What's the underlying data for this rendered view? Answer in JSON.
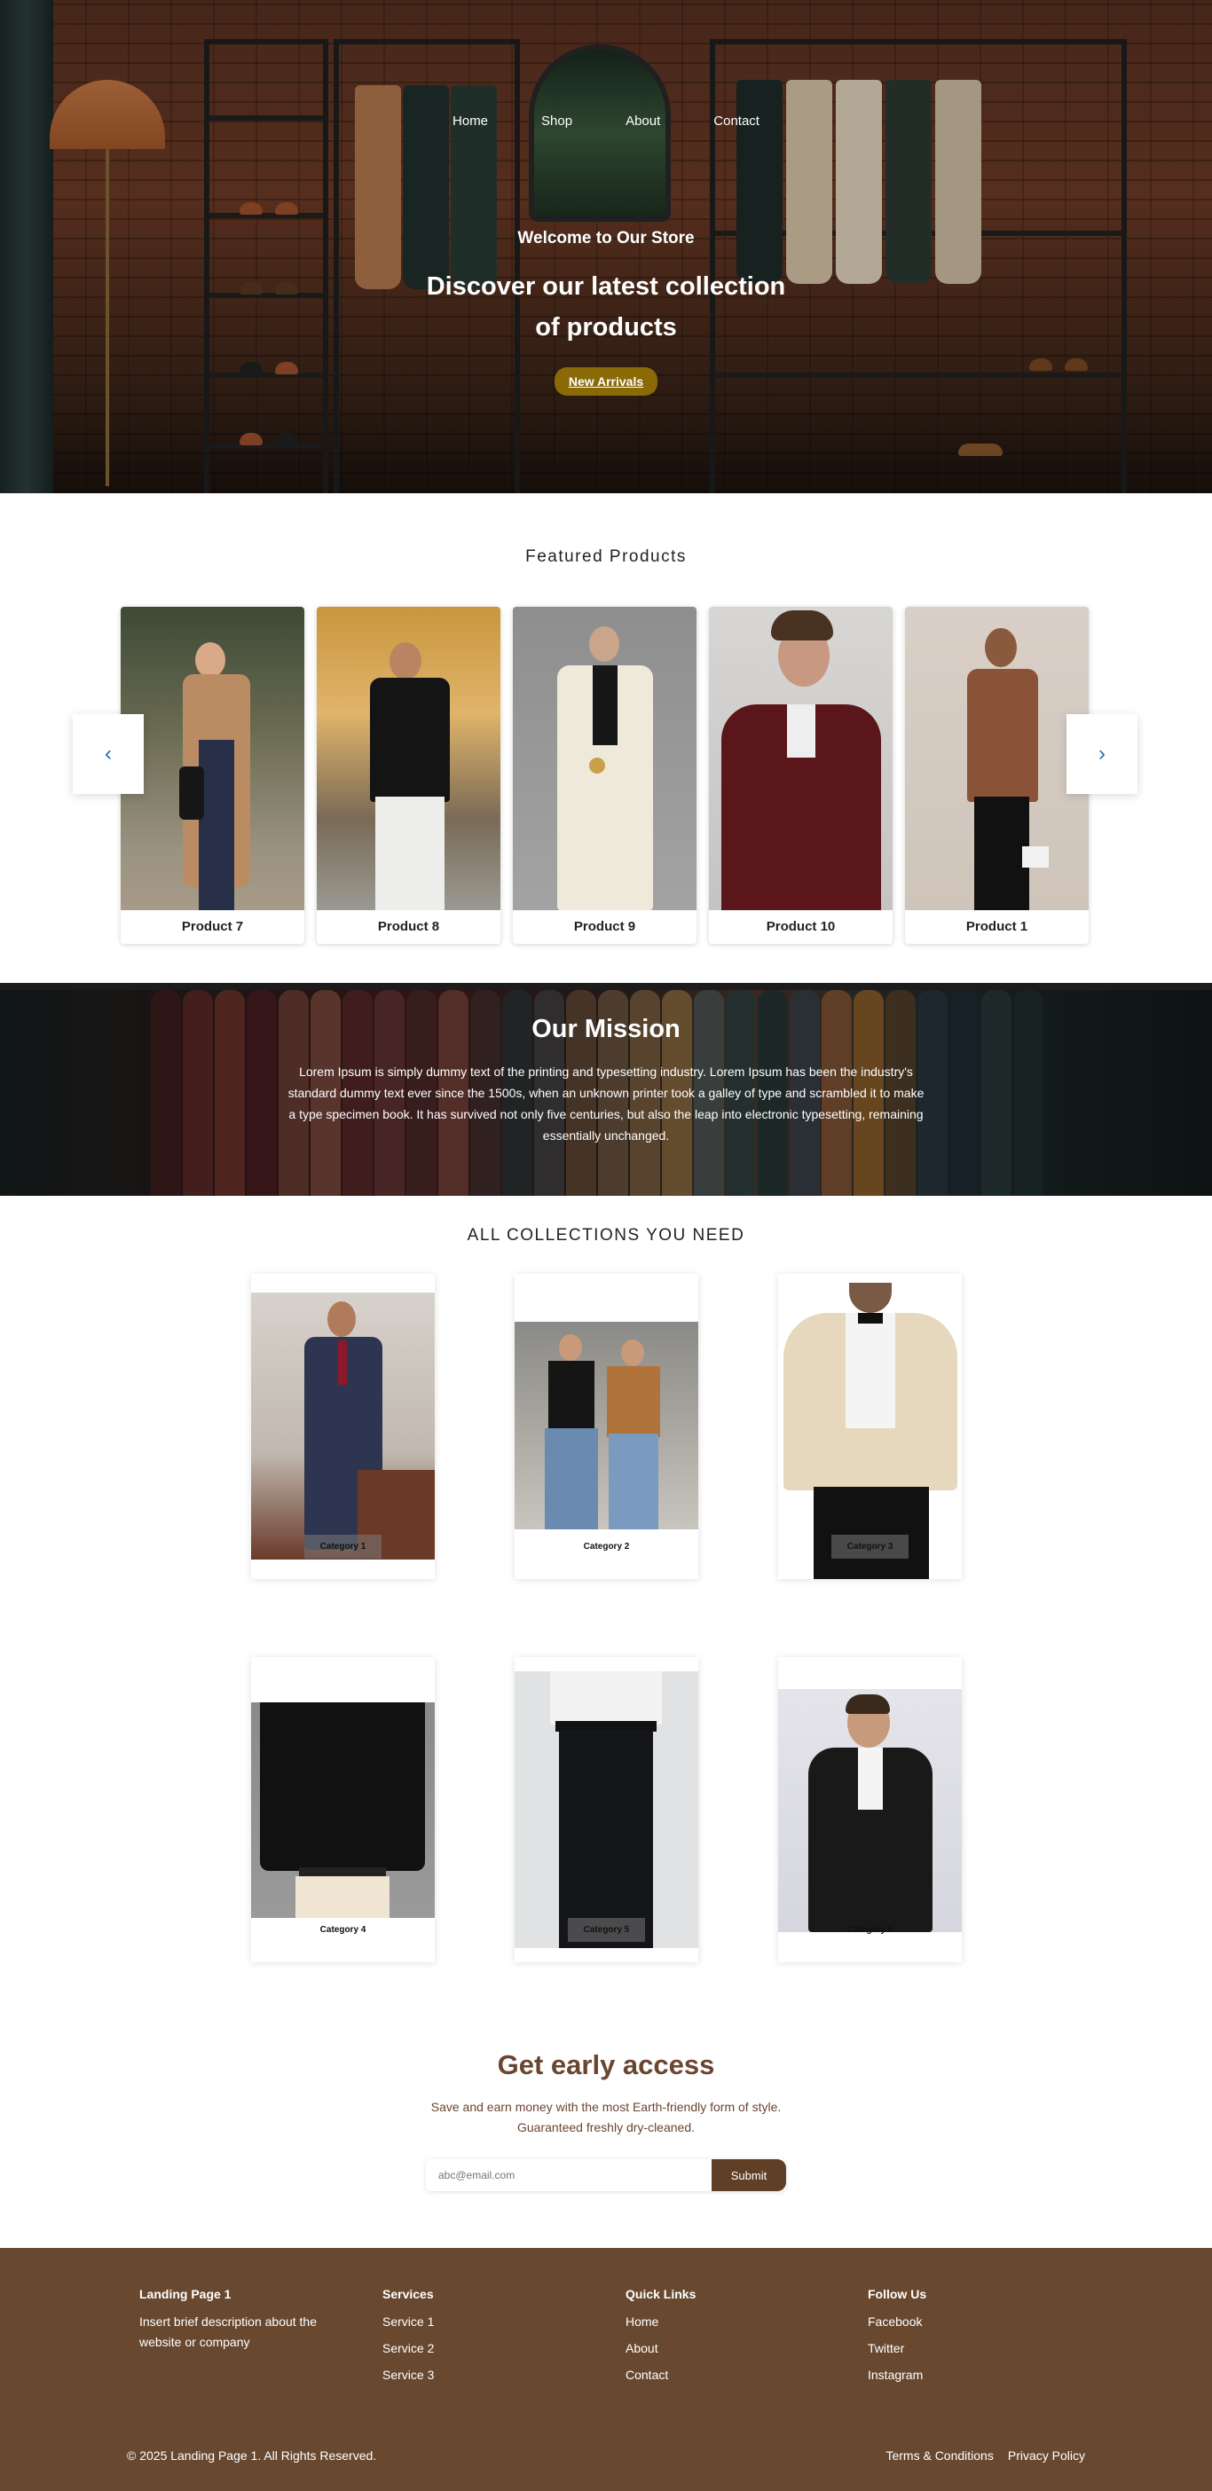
{
  "nav": {
    "items": [
      {
        "label": "Home"
      },
      {
        "label": "Shop"
      },
      {
        "label": "About"
      },
      {
        "label": "Contact"
      }
    ]
  },
  "hero": {
    "welcome": "Welcome to Our Store",
    "headline_line1": "Discover our latest collection",
    "headline_line2": "of products",
    "button_label": "New Arrivals"
  },
  "featured": {
    "title": "Featured Products",
    "prev_icon": "chevron-left-icon",
    "next_icon": "chevron-right-icon",
    "products": [
      {
        "name": "Product 7"
      },
      {
        "name": "Product 8"
      },
      {
        "name": "Product 9"
      },
      {
        "name": "Product 10"
      },
      {
        "name": "Product 1"
      }
    ]
  },
  "mission": {
    "title": "Our Mission",
    "text": "Lorem Ipsum is simply dummy text of the printing and typesetting industry. Lorem Ipsum has been the industry's standard dummy text ever since the 1500s, when an unknown printer took a galley of type and scrambled it to make a type specimen book. It has survived not only five centuries, but also the leap into electronic typesetting, remaining essentially unchanged."
  },
  "collections": {
    "title": "ALL COLLECTIONS YOU NEED",
    "categories": [
      {
        "name": "Category 1"
      },
      {
        "name": "Category 2"
      },
      {
        "name": "Category 3"
      },
      {
        "name": "Category 4"
      },
      {
        "name": "Category 5"
      },
      {
        "name": "Category 6"
      }
    ]
  },
  "early_access": {
    "title": "Get early access",
    "text": "Save and earn money with the most Earth-friendly form of style. Guaranteed freshly dry-cleaned.",
    "email_placeholder": "abc@email.com",
    "submit_label": "Submit"
  },
  "footer": {
    "brand_title": "Landing Page 1",
    "brand_desc": "Insert brief description about the website or company",
    "services_title": "Services",
    "services": [
      "Service 1",
      "Service 2",
      "Service 3"
    ],
    "quick_links_title": "Quick Links",
    "quick_links": [
      "Home",
      "About",
      "Contact"
    ],
    "follow_title": "Follow Us",
    "social": [
      "Facebook",
      "Twitter",
      "Instagram"
    ],
    "copyright": "© 2025 Landing Page 1. All Rights Reserved.",
    "terms": "Terms & Conditions",
    "privacy": "Privacy Policy"
  },
  "colors": {
    "brand_brown": "#684930",
    "hero_button": "#8a6a06",
    "carousel_arrow": "#1d6fb8",
    "early_access_text": "#6a4530"
  }
}
